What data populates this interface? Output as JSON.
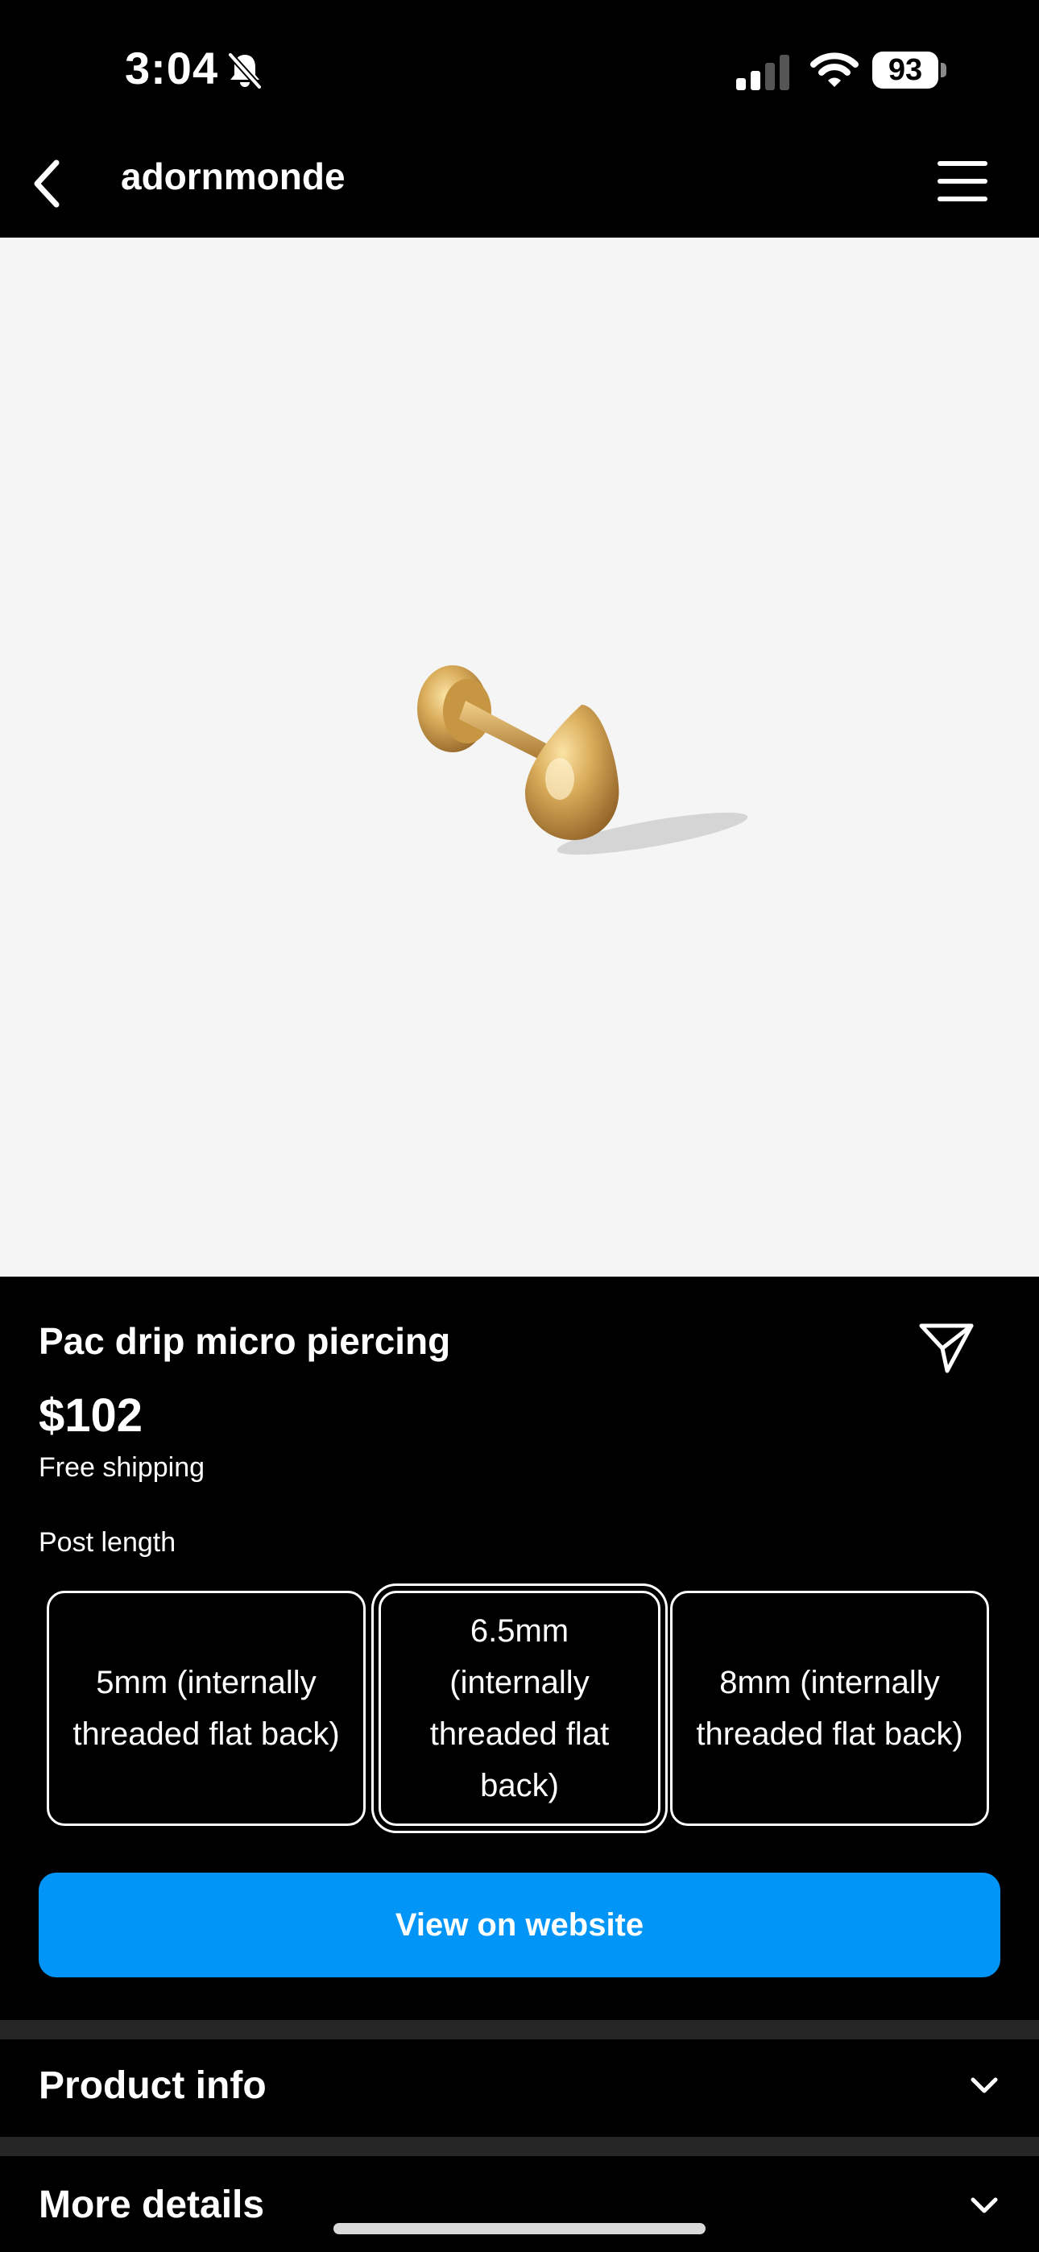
{
  "status_bar": {
    "time": "3:04",
    "battery": "93",
    "icons": [
      "bell-slash-icon",
      "signal-icon",
      "wifi-icon",
      "battery-icon"
    ]
  },
  "header": {
    "title": "adornmonde",
    "icons": [
      "back-icon",
      "menu-icon"
    ]
  },
  "product": {
    "image": "gold-teardrop-micro-piercing",
    "title": "Pac drip micro piercing",
    "price": "$102",
    "shipping": "Free shipping",
    "option_label": "Post length",
    "options": [
      {
        "label": "5mm (internally threaded flat back)",
        "selected": false
      },
      {
        "label": "6.5mm (internally threaded flat back)",
        "selected": true
      },
      {
        "label": "8mm (internally threaded flat back)",
        "selected": false
      }
    ],
    "cta_label": "View on website"
  },
  "sections": [
    {
      "title": "Product info"
    },
    {
      "title": "More details"
    }
  ],
  "colors": {
    "background": "#000000",
    "accent": "#0095f6",
    "image_background": "#f5f5f5",
    "divider": "#262626"
  }
}
